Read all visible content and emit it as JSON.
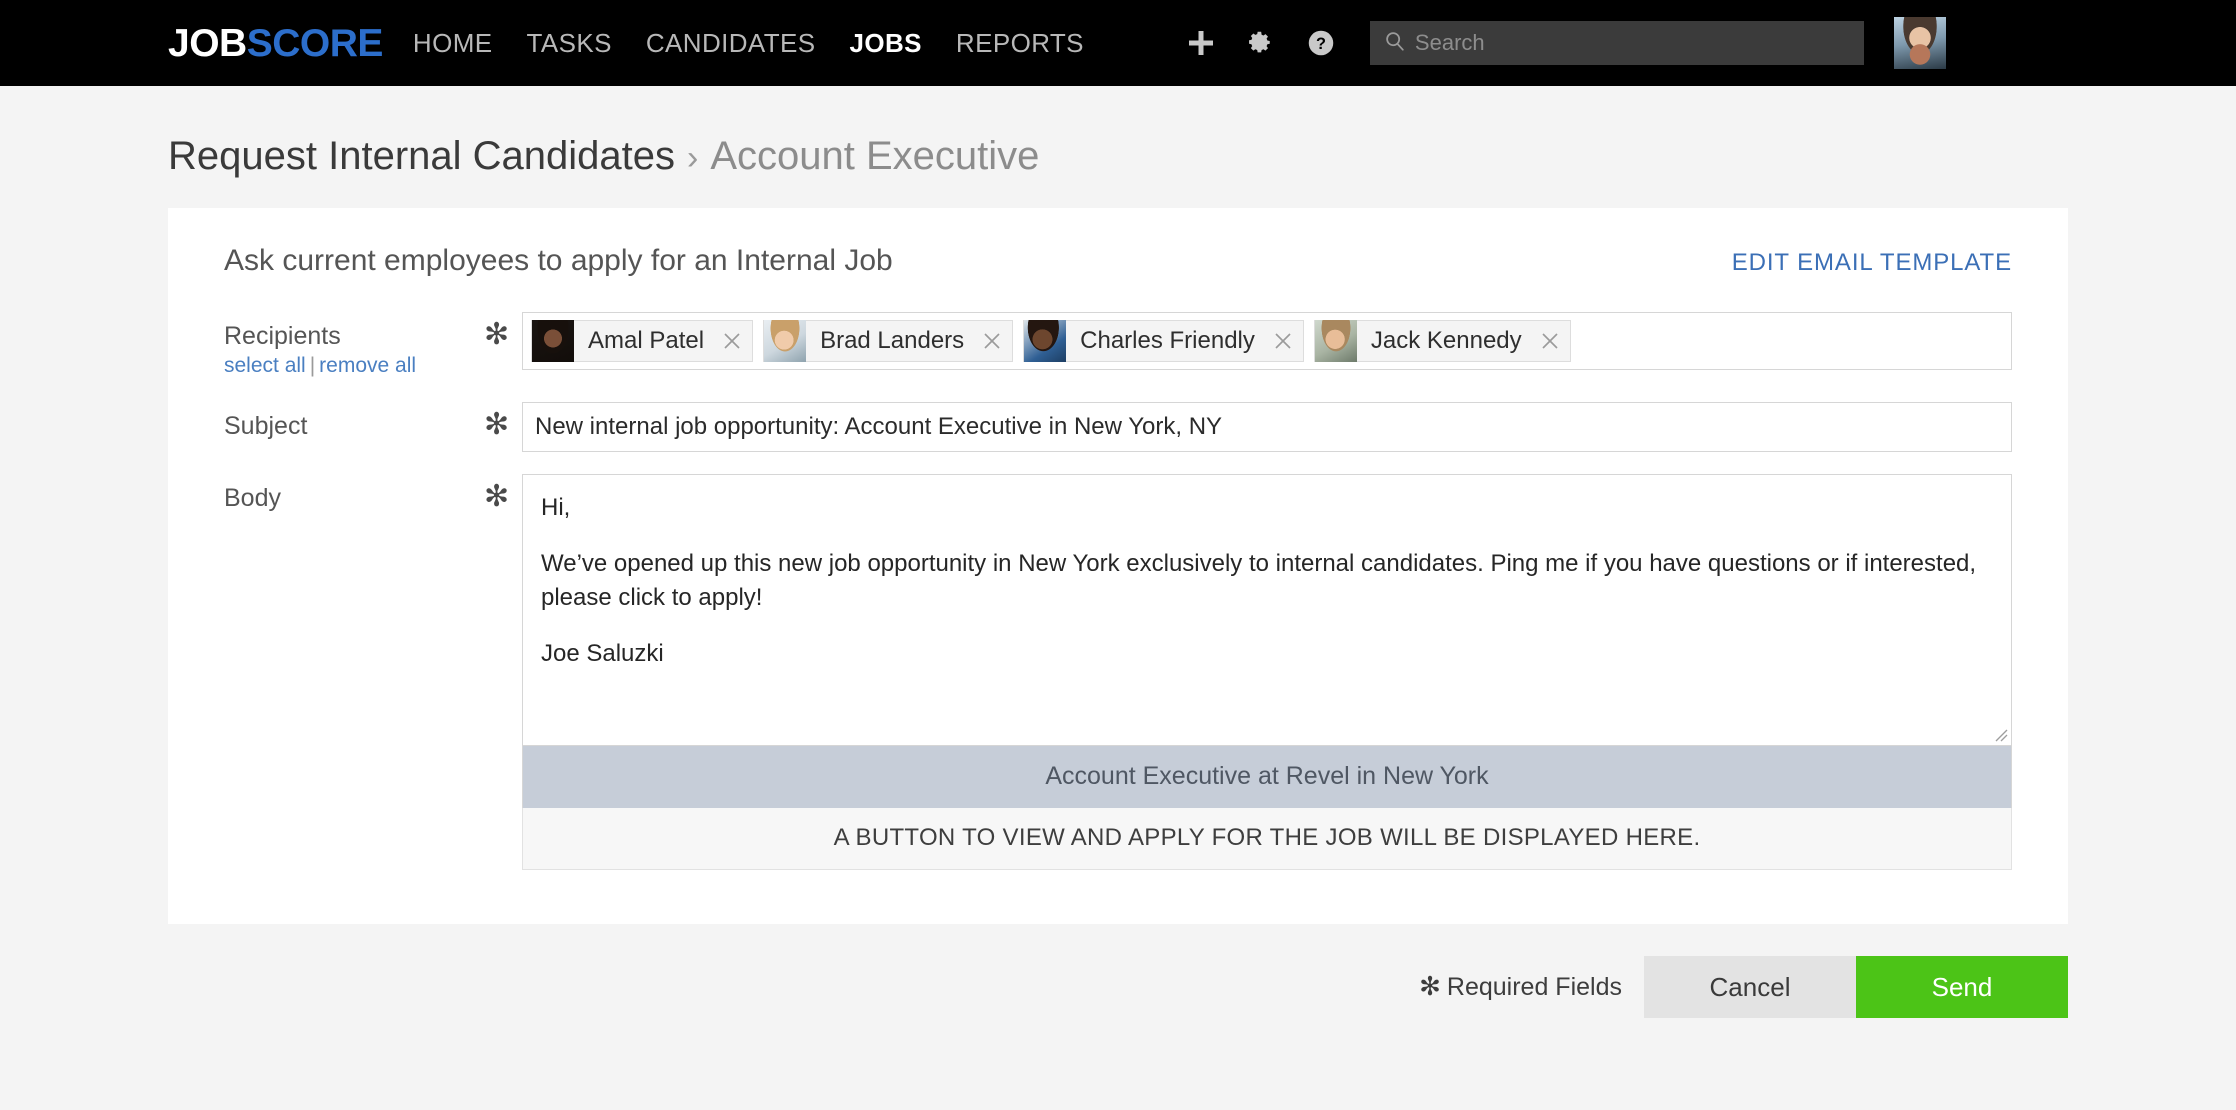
{
  "nav": {
    "logo": {
      "part1": "JOB",
      "part2": "SCORE"
    },
    "links": [
      {
        "label": "HOME",
        "active": false
      },
      {
        "label": "TASKS",
        "active": false
      },
      {
        "label": "CANDIDATES",
        "active": false
      },
      {
        "label": "JOBS",
        "active": true
      },
      {
        "label": "REPORTS",
        "active": false
      }
    ],
    "icons": [
      "plus-icon",
      "gear-icon",
      "help-icon"
    ],
    "search": {
      "placeholder": "Search",
      "value": ""
    },
    "avatar_alt": "Joe Saluzki"
  },
  "breadcrumb": {
    "parent": "Request Internal Candidates",
    "separator": "›",
    "current": "Account Executive"
  },
  "card": {
    "title": "Ask current employees to apply for an Internal Job",
    "edit_template_label": "EDIT EMAIL TEMPLATE",
    "required_marker": "✻",
    "recipients": {
      "label": "Recipients",
      "select_all_label": "select all",
      "links_divider": "|",
      "remove_all_label": "remove all",
      "chips": [
        {
          "name": "Amal Patel",
          "photo": "photo-amal",
          "remove_icon": "close-icon"
        },
        {
          "name": "Brad Landers",
          "photo": "photo-brad",
          "remove_icon": "close-icon"
        },
        {
          "name": "Charles Friendly",
          "photo": "photo-charles",
          "remove_icon": "close-icon"
        },
        {
          "name": "Jack Kennedy",
          "photo": "photo-jack",
          "remove_icon": "close-icon"
        }
      ]
    },
    "subject": {
      "label": "Subject",
      "value": "New internal job opportunity: Account Executive in New York, NY",
      "placeholder": ""
    },
    "body": {
      "label": "Body",
      "greeting": "Hi,",
      "paragraph": "We’ve opened up this new job opportunity in New York exclusively to internal candidates.  Ping me if you have questions or if interested, please click to apply!",
      "signature": "Joe Saluzki"
    },
    "preview": {
      "job_bar": "Account Executive at Revel in New York",
      "button_note": "A BUTTON TO VIEW AND APPLY FOR THE JOB WILL BE DISPLAYED HERE."
    }
  },
  "footer": {
    "required_star": "✻",
    "required_label": "Required Fields",
    "cancel_label": "Cancel",
    "send_label": "Send"
  },
  "colors": {
    "nav_bg": "#000000",
    "logo_blue": "#2c6ecb",
    "link_blue": "#3b6fb6",
    "send_green": "#4cc417",
    "cancel_gray": "#e3e3e3",
    "page_bg": "#f4f4f4",
    "preview_bar": "#c6cdd8"
  }
}
